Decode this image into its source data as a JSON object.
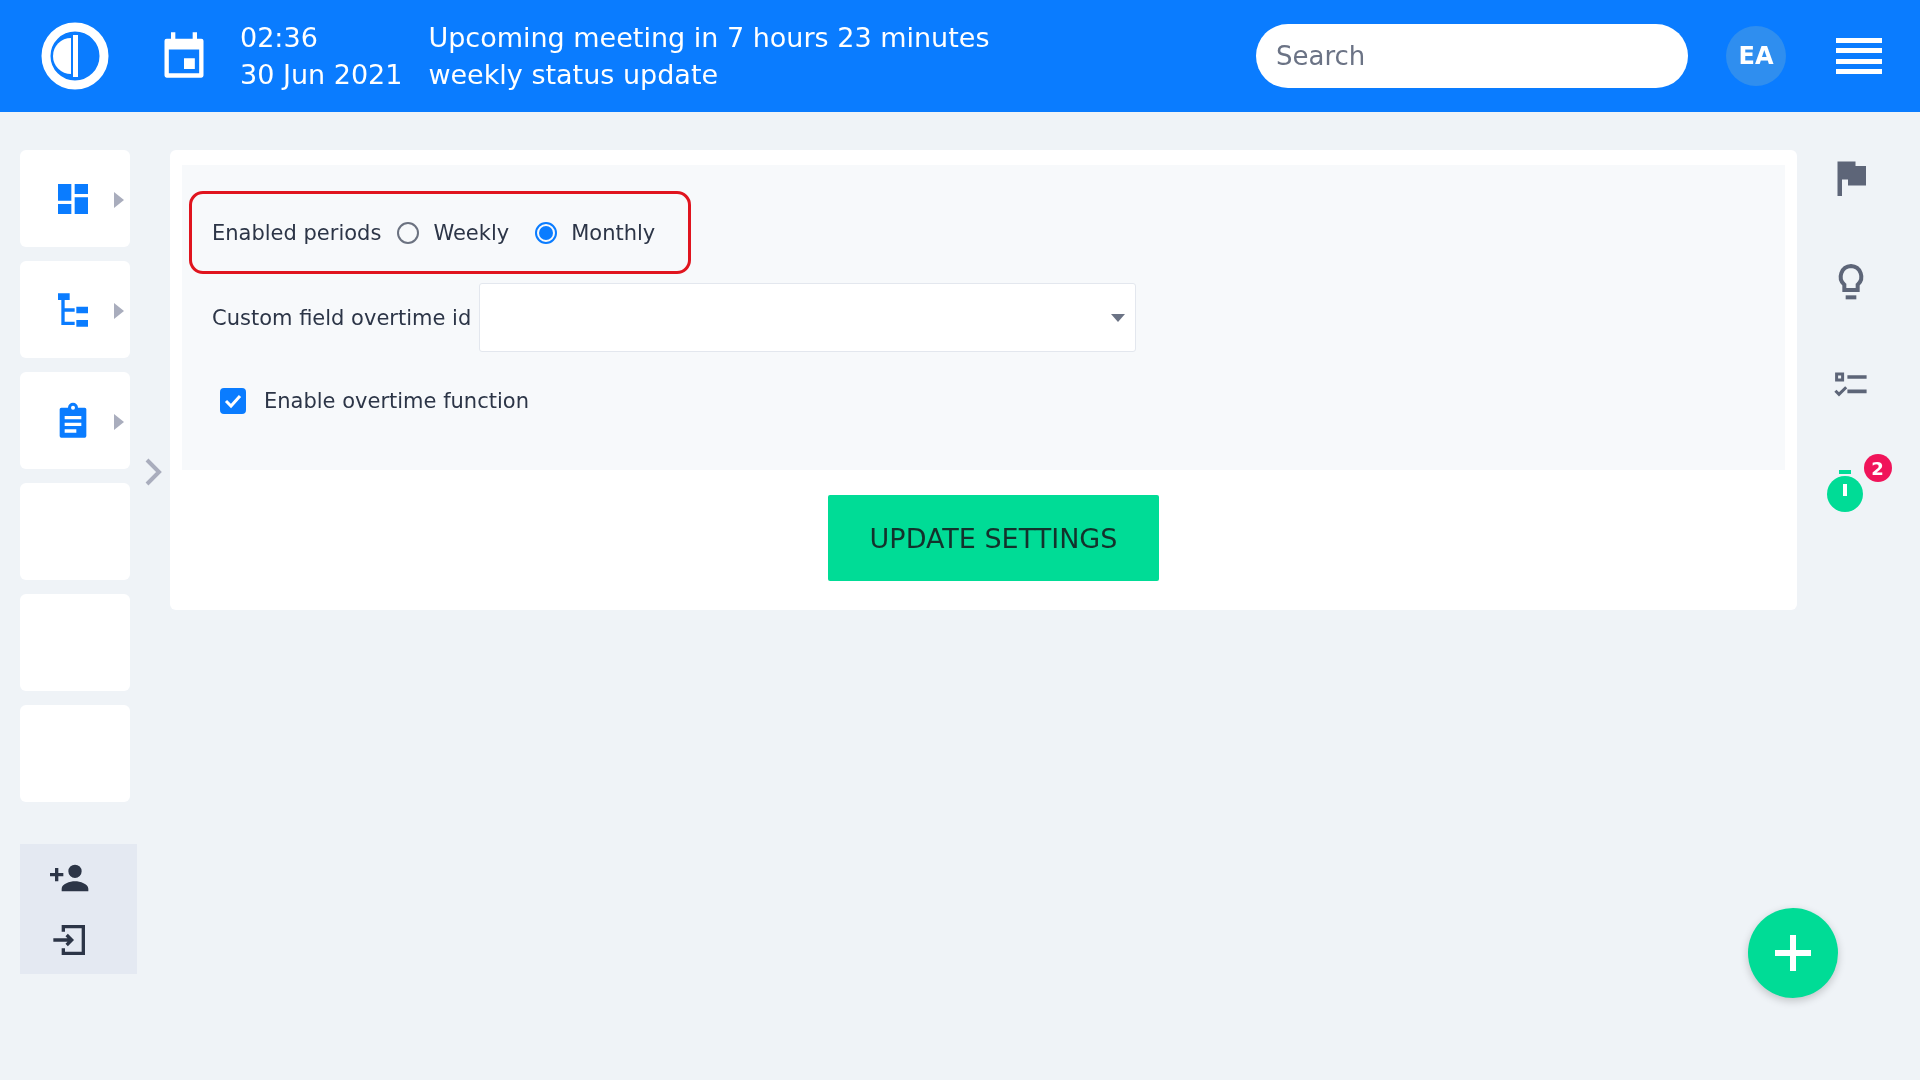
{
  "header": {
    "time": "02:36",
    "meeting": "Upcoming meeting in 7 hours 23 minutes",
    "date": "30 Jun 2021",
    "meeting_title": "weekly status update",
    "search": {
      "placeholder": "Search"
    },
    "avatar": "EA"
  },
  "sidebar": {
    "items": [
      {
        "kind": "dashboard"
      },
      {
        "kind": "tree"
      },
      {
        "kind": "clipboard"
      },
      {
        "kind": "empty"
      },
      {
        "kind": "empty"
      },
      {
        "kind": "empty"
      }
    ]
  },
  "form": {
    "periods": {
      "label": "Enabled periods",
      "options": [
        {
          "label": "Weekly",
          "selected": false
        },
        {
          "label": "Monthly",
          "selected": true
        }
      ]
    },
    "custom_field": {
      "label": "Custom field overtime id"
    },
    "overtime": {
      "label": "Enable overtime function",
      "checked": true
    },
    "submit": "UPDATE SETTINGS"
  },
  "right_panel": {
    "timer_badge": "2"
  }
}
